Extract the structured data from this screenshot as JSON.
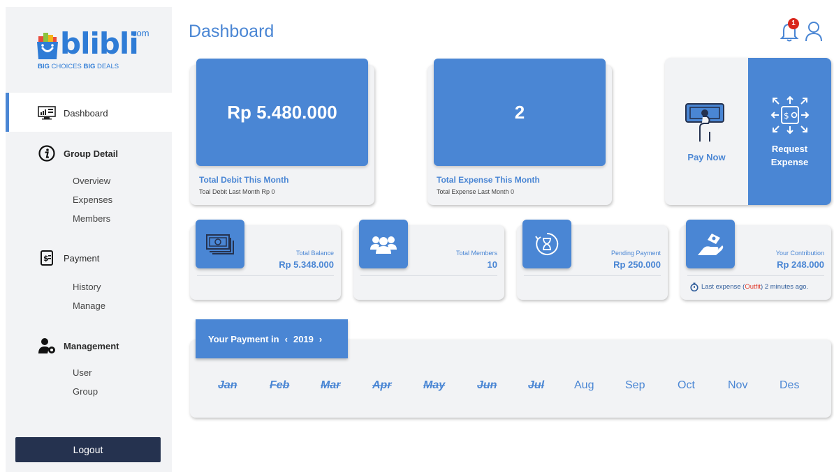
{
  "brand": {
    "logo_word": "blibli",
    "logo_com": "com",
    "tagline_a": "BIG",
    "tagline_b": " CHOICES ",
    "tagline_c": "BIG",
    "tagline_d": " DEALS",
    "accent": "#4a86d4"
  },
  "sidebar": {
    "dashboard": "Dashboard",
    "group_detail": {
      "label": "Group Detail",
      "items": [
        "Overview",
        "Expenses",
        "Members"
      ]
    },
    "payment": {
      "label": "Payment",
      "items": [
        "History",
        "Manage"
      ]
    },
    "management": {
      "label": "Management",
      "items": [
        "User",
        "Group"
      ]
    },
    "logout": "Logout"
  },
  "header": {
    "title": "Dashboard",
    "notification_count": "1"
  },
  "summary": {
    "debit": {
      "value": "Rp 5.480.000",
      "title": "Total Debit This Month",
      "sub": "Toal Debit Last Month Rp 0"
    },
    "expense": {
      "value": "2",
      "title": "Total Expense This Month",
      "sub": "Total Expense Last Month 0"
    }
  },
  "actions": {
    "pay_now": "Pay Now",
    "request_expense_1": "Request",
    "request_expense_2": "Expense"
  },
  "stats": [
    {
      "label": "Total Balance",
      "value": "Rp 5.348.000",
      "icon": "money-icon"
    },
    {
      "label": "Total Members",
      "value": "10",
      "icon": "users-icon"
    },
    {
      "label": "Pending Payment",
      "value": "Rp 250.000",
      "icon": "hourglass-icon"
    },
    {
      "label": "Your Contribution",
      "value": "Rp 248.000",
      "icon": "hand-coin-icon"
    }
  ],
  "last_expense": {
    "prefix": "Last expense (",
    "name": "Outfit",
    "suffix": ") 2 minutes ago."
  },
  "payments": {
    "title": "Your Payment in",
    "year": "2019",
    "prev": "‹",
    "next": "›",
    "months": [
      "Jan",
      "Feb",
      "Mar",
      "Apr",
      "May",
      "Jun",
      "Jul",
      "Aug",
      "Sep",
      "Oct",
      "Nov",
      "Des"
    ],
    "paid": [
      true,
      true,
      true,
      true,
      true,
      true,
      true,
      false,
      false,
      false,
      false,
      false
    ]
  }
}
